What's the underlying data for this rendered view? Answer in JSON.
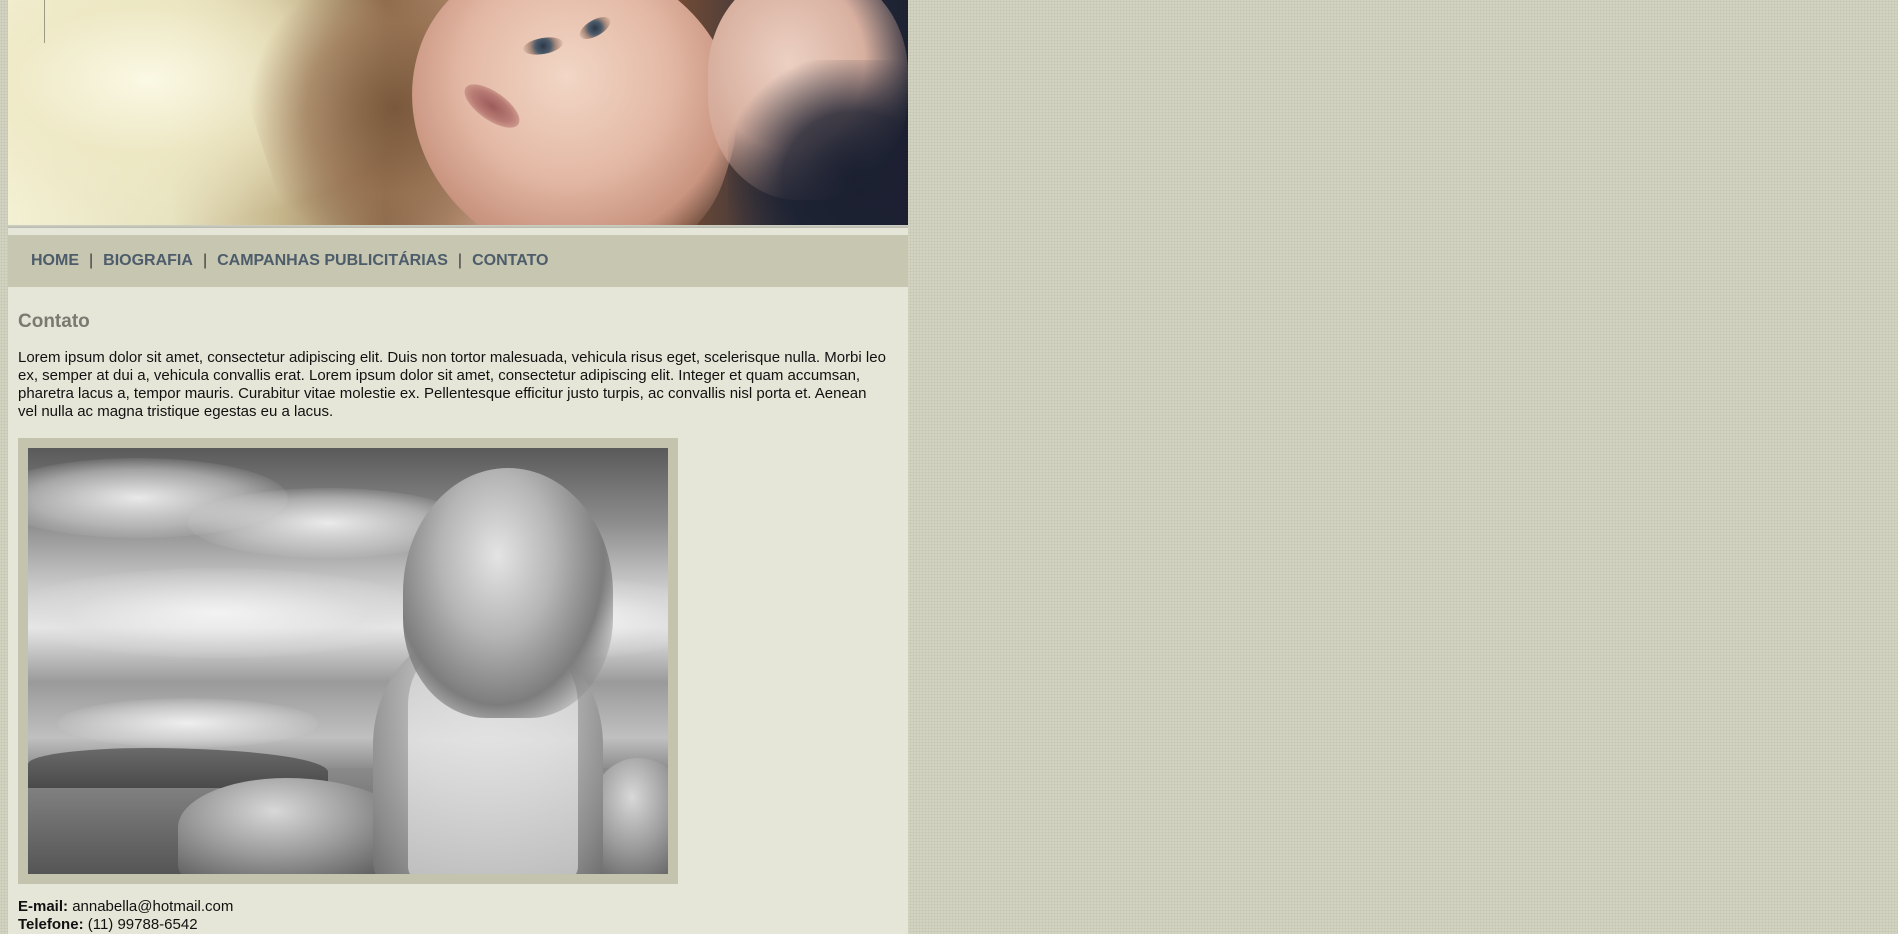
{
  "header": {
    "image_alt": "Header photo of a woman with long hair, hand on head"
  },
  "nav": {
    "items": [
      {
        "label": "HOME"
      },
      {
        "label": "BIOGRAFIA"
      },
      {
        "label": "CAMPANHAS PUBLICITÁRIAS"
      },
      {
        "label": "CONTATO"
      }
    ],
    "separator": "|"
  },
  "content": {
    "title": "Contato",
    "intro": "Lorem ipsum dolor sit amet, consectetur adipiscing elit. Duis non tortor malesuada, vehicula risus eget, scelerisque nulla. Morbi leo ex, semper at dui a, vehicula convallis erat. Lorem ipsum dolor sit amet, consectetur adipiscing elit. Integer et quam accumsan, pharetra lacus a, tempor mauris. Curabitur vitae molestie ex. Pellentesque efficitur justo turpis, ac convallis nisl porta et. Aenean vel nulla ac magna tristique egestas eu a lacus.",
    "photo_alt": "Black and white photo of a woman with windblown hair looking at the sea",
    "contact": {
      "email_label": "E-mail:",
      "email_value": "annabella@hotmail.com",
      "phone_label": "Telefone:",
      "phone_value": "(11) 99788-6542"
    }
  },
  "colors": {
    "page_background": "#d3d3c1",
    "wrapper_background": "#e6e6d8",
    "nav_background": "#c6c6b1",
    "nav_link": "#4d5c6a",
    "title": "#7a7a70",
    "photo_frame": "#c4c4ae"
  }
}
